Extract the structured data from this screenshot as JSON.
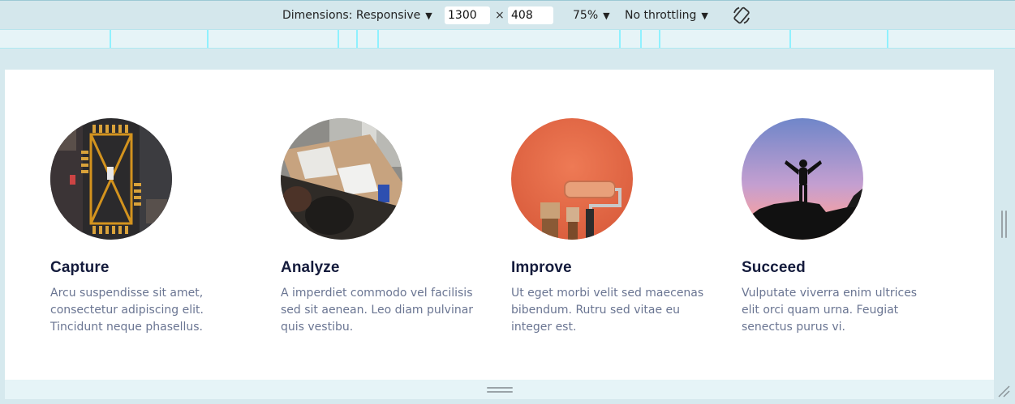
{
  "toolbar": {
    "dimensions_label": "Dimensions: Responsive",
    "width_value": "1300",
    "height_value": "408",
    "times": "×",
    "zoom": "75%",
    "throttling": "No throttling",
    "rotate_icon": "rotate-icon"
  },
  "features": [
    {
      "title": "Capture",
      "text": "Arcu suspendisse sit amet, consectetur adipiscing elit. Tincidunt neque phasellus."
    },
    {
      "title": "Analyze",
      "text": "A imperdiet commodo vel facilisis sed sit aenean. Leo diam pulvinar quis vestibu."
    },
    {
      "title": "Improve",
      "text": "Ut eget morbi velit sed maecenas bibendum. Rutru sed vitae eu integer est."
    },
    {
      "title": "Succeed",
      "text": "Vulputate viverra enim ultrices elit orci quam urna. Feugiat senectus purus vi."
    }
  ]
}
